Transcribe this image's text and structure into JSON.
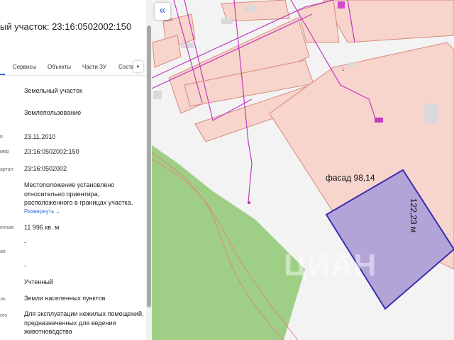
{
  "panel": {
    "title": "ый участок: 23:16:0502002:150",
    "tabs": [
      "",
      "Сервисы",
      "Объекты",
      "Части ЗУ",
      "Соста"
    ],
    "fields": [
      {
        "label": "",
        "value": "Земельный участок"
      },
      {
        "label": "",
        "value": "Землепользование"
      },
      {
        "label": "я",
        "value": "23.11.2010"
      },
      {
        "label": "мер",
        "value": "23:16:0502002:150"
      },
      {
        "label": "артал",
        "value": "23:16:0502002"
      },
      {
        "label": "",
        "value": "Местоположение установлено относительно ориентира, расположенного в границах участка."
      },
      {
        "label": "енная",
        "value": "11 996 кв. м"
      },
      {
        "label": "ая",
        "value": "-"
      },
      {
        "label": "",
        "value": "-"
      },
      {
        "label": "",
        "value": "Учтенный"
      },
      {
        "label": "ль",
        "value": "Земли населенных пунктов"
      },
      {
        "label": "ого",
        "value": "Для эксплуатации нежилых помещений, предназначенных для ведения животноводства"
      }
    ],
    "expand_label": "Развернуть",
    "expand_icon": "chevron-down-icon"
  },
  "map": {
    "collapse_icon": "double-chevron-left-icon",
    "labels": {
      "facade": "фасад 98,14",
      "side": "122,23 м",
      "small1": "26/1",
      "small2": "1"
    },
    "watermark": "ЦИАН",
    "colors": {
      "parcel": "#b3a4d8",
      "parcel_border": "#3a2fb0",
      "green": "#9fcf86",
      "buildings": "#f7d4cc",
      "building_border": "#d98a7c",
      "road": "#c23bbf"
    }
  }
}
